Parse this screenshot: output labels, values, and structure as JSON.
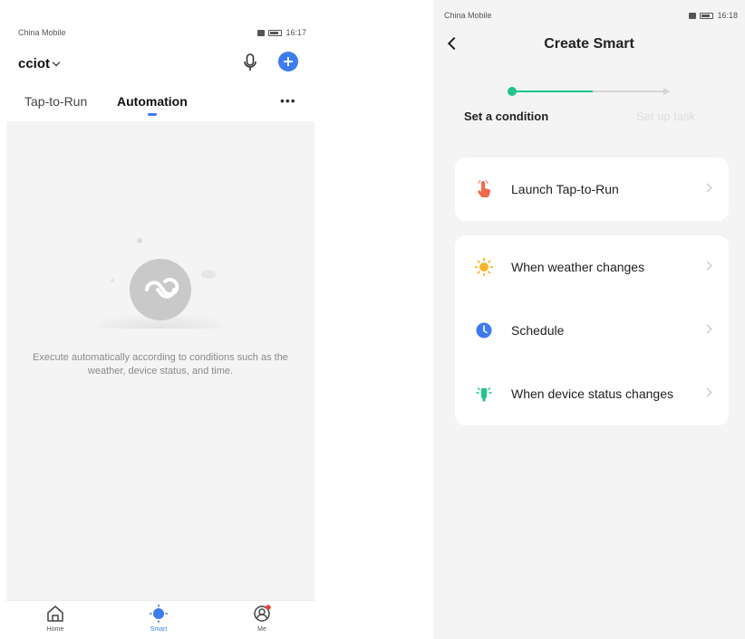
{
  "left_screen": {
    "status_bar": {
      "carrier": "China Mobile",
      "time": "16:17"
    },
    "home": {
      "name": "cciot"
    },
    "tabs": [
      {
        "label": "Tap-to-Run"
      },
      {
        "label": "Automation"
      }
    ],
    "empty_state": {
      "message": "Execute automatically according to conditions such as the weather, device status, and time."
    },
    "tabbar": [
      {
        "label": "Home",
        "icon": "home-icon"
      },
      {
        "label": "Smart",
        "icon": "smart-icon"
      },
      {
        "label": "Me",
        "icon": "profile-icon"
      }
    ],
    "colors": {
      "accent": "#3d7bf0"
    }
  },
  "right_screen": {
    "status_bar": {
      "carrier": "China Mobile",
      "time": "16:18"
    },
    "title": "Create Smart",
    "steps": [
      {
        "label": "Set a condition",
        "active": true
      },
      {
        "label": "Set up task",
        "active": false
      }
    ],
    "options_group_1": [
      {
        "label": "Launch Tap-to-Run",
        "icon": "tap-hand-icon"
      }
    ],
    "options_group_2": [
      {
        "label": "When weather changes",
        "icon": "sun-icon"
      },
      {
        "label": "Schedule",
        "icon": "clock-icon"
      },
      {
        "label": "When device status changes",
        "icon": "device-status-icon"
      }
    ],
    "colors": {
      "step_active": "#21c48a"
    }
  }
}
